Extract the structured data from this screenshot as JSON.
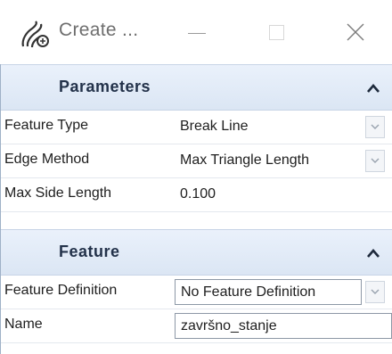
{
  "window": {
    "title": "Create ...",
    "app_icon": "feature-tool-icon",
    "controls": [
      "minimize-icon",
      "maximize-icon",
      "close-icon"
    ]
  },
  "sections": {
    "parameters": {
      "title": "Parameters",
      "collapse_icon": "chevron-up-icon",
      "rows": [
        {
          "label": "Feature Type",
          "value": "Break Line"
        },
        {
          "label": "Edge Method",
          "value": "Max Triangle Length"
        },
        {
          "label": "Max Side Length",
          "value": "0.100"
        }
      ]
    },
    "feature": {
      "title": "Feature",
      "collapse_icon": "chevron-up-icon",
      "rows": [
        {
          "label": "Feature Definition",
          "value": "No Feature Definition"
        },
        {
          "label": "Name",
          "value": "završno_stanje"
        }
      ]
    }
  },
  "colors": {
    "section_header_bg": "#dbe6f4",
    "section_header_text": "#23324a",
    "field_border": "#8d98a6"
  }
}
